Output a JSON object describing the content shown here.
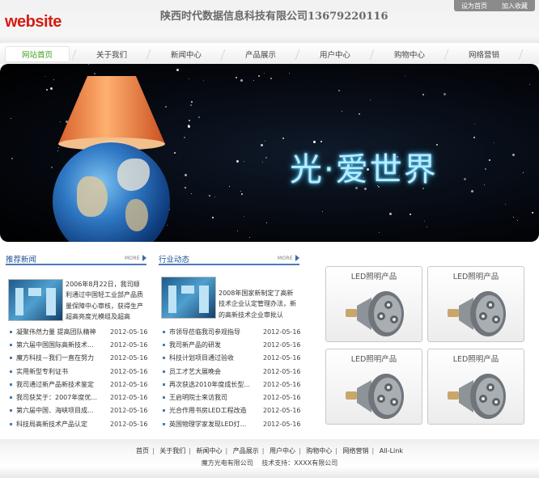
{
  "header": {
    "logo_text": "website",
    "company": "陕西时代数据信息科技有限公司13679220116",
    "top_links": [
      "设为首页",
      "加入收藏"
    ]
  },
  "nav": {
    "items": [
      "网站首页",
      "关于我们",
      "新闻中心",
      "产品展示",
      "用户中心",
      "购物中心",
      "网络营销"
    ],
    "active_index": 0,
    "active_color": "#3ea01a"
  },
  "banner": {
    "slogan": "光·爱世界"
  },
  "news_left": {
    "title": "推荐新闻",
    "more": "MORE",
    "intro": "2006年8月22日，我司顺利通过中国轻工业部产品质量保障中心审核，获得生产超高亮度光模组及超高",
    "items": [
      {
        "title": "凝聚伟然力量 提高团队精神",
        "date": "2012-05-16"
      },
      {
        "title": "第六届中国国际高新技术...",
        "date": "2012-05-16"
      },
      {
        "title": "魔方科技－我们一直在努力",
        "date": "2012-05-16"
      },
      {
        "title": "实用新型专利证书",
        "date": "2012-05-16"
      },
      {
        "title": "我司通过新产品新技术鉴定",
        "date": "2012-05-16"
      },
      {
        "title": "我司获奖于：2007年度优...",
        "date": "2012-05-16"
      },
      {
        "title": "第六届中国．海峡项目成...",
        "date": "2012-05-16"
      },
      {
        "title": "科技局高新技术产品认定",
        "date": "2012-05-16"
      }
    ]
  },
  "news_right": {
    "title": "行业动态",
    "more": "MORE",
    "intro": "2008年国家新制定了高新技术企业认定管理办法，新的高新技术企业审批认",
    "items": [
      {
        "title": "市领导莅临我司参观指导",
        "date": "2012-05-16"
      },
      {
        "title": "我司新产品的研发",
        "date": "2012-05-16"
      },
      {
        "title": "科技计划项目通过验收",
        "date": "2012-05-16"
      },
      {
        "title": "员工才艺大展晚会",
        "date": "2012-05-16"
      },
      {
        "title": "再次获选2010年度成长型...",
        "date": "2012-05-16"
      },
      {
        "title": "王启明院士来访我司",
        "date": "2012-05-16"
      },
      {
        "title": "光合作用书房LED工程改造",
        "date": "2012-05-16"
      },
      {
        "title": "英国物理学家发现LED灯...",
        "date": "2012-05-16"
      }
    ]
  },
  "products": [
    {
      "label": "LED照明产品"
    },
    {
      "label": "LED照明产品"
    },
    {
      "label": "LED照明产品"
    },
    {
      "label": "LED照明产品"
    }
  ],
  "footer": {
    "links": [
      "首页",
      "关于我们",
      "新闻中心",
      "产品展示",
      "用户中心",
      "购物中心",
      "网络营销",
      "All-Link"
    ],
    "company": "魔方光电有限公司",
    "support": "技术支持：XXXX有限公司"
  }
}
